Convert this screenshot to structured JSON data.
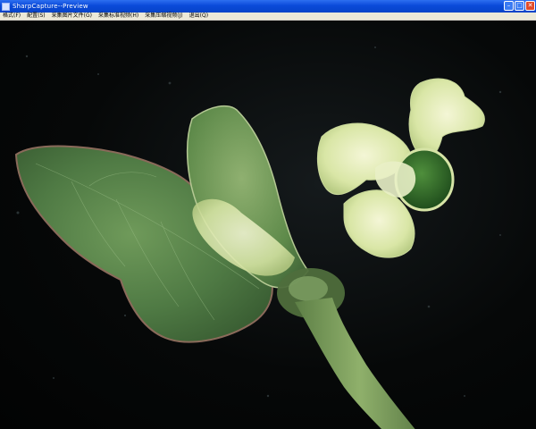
{
  "window": {
    "title": "SharpCapture--Preview"
  },
  "menubar": {
    "items": [
      {
        "label": "格式(F)"
      },
      {
        "label": "配置(S)"
      },
      {
        "label": "采集图片文件(G)"
      },
      {
        "label": "采集标准视频(H)"
      },
      {
        "label": "采集压缩视频(J)"
      },
      {
        "label": "退出(Q)"
      }
    ]
  },
  "colors": {
    "titlebar": "#0a4ad9",
    "menubar": "#ece9d8",
    "background": "#040606"
  }
}
